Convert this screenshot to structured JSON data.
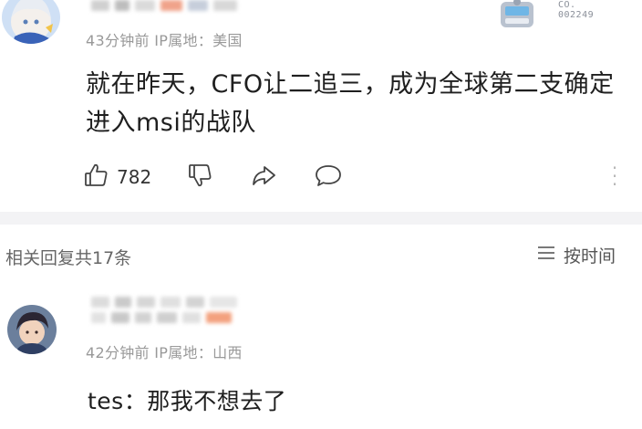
{
  "comment": {
    "meta": "43分钟前 IP属地：美国",
    "badge_code": "CO.\n002249",
    "text": "就在昨天，CFO让二追三，成为全球第二支确定进入msi的战队",
    "like_count": "782"
  },
  "replies_header": {
    "count_label": "相关回复共17条",
    "sort_label": "按时间"
  },
  "reply": {
    "meta": "42分钟前 IP属地：山西",
    "text": "tes：那我不想去了"
  },
  "icons": [
    "avatar",
    "badge-icon",
    "thumb-up-icon",
    "thumb-down-icon",
    "share-icon",
    "comment-icon",
    "more-vertical-icon",
    "sort-list-icon"
  ],
  "colors": {
    "meta_text": "#999999",
    "body_text": "#1f1f1f",
    "separator": "#f3f3f5"
  }
}
